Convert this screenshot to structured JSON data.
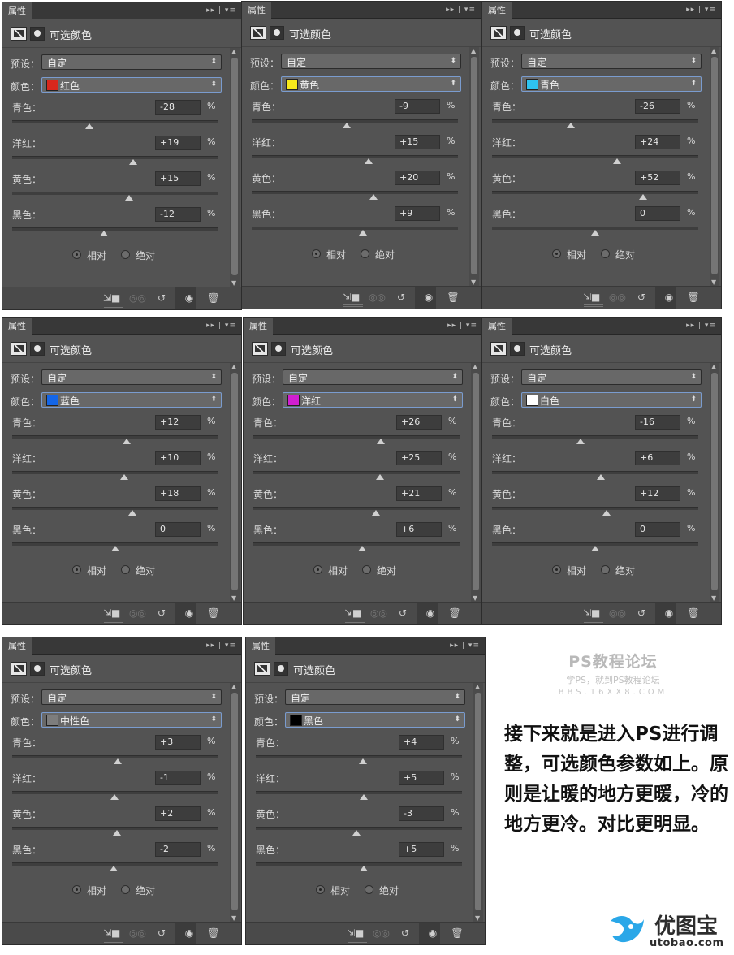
{
  "panel_common": {
    "tab_label": "属性",
    "tab_controls": "▸▸ | ▾≡",
    "title": "可选颜色",
    "preset_label": "预设：",
    "preset_value": "自定",
    "color_label": "颜色：",
    "pct": "%",
    "relative_label": "相对",
    "absolute_label": "绝对",
    "rows": [
      "青色：",
      "洋红：",
      "黄色：",
      "黑色："
    ]
  },
  "panels": [
    {
      "color_name": "红色",
      "swatch": "#d8281c",
      "values": [
        "-28",
        "+19",
        "+15",
        "-12"
      ]
    },
    {
      "color_name": "黄色",
      "swatch": "#f7e91b",
      "values": [
        "-9",
        "+15",
        "+20",
        "+9"
      ]
    },
    {
      "color_name": "青色",
      "swatch": "#2ec3f0",
      "values": [
        "-26",
        "+24",
        "+52",
        "0"
      ]
    },
    {
      "color_name": "蓝色",
      "swatch": "#1466e8",
      "values": [
        "+12",
        "+10",
        "+18",
        "0"
      ]
    },
    {
      "color_name": "洋红",
      "swatch": "#d11ed1",
      "values": [
        "+26",
        "+25",
        "+21",
        "+6"
      ]
    },
    {
      "color_name": "白色",
      "swatch": "#ffffff",
      "values": [
        "-16",
        "+6",
        "+12",
        "0"
      ]
    },
    {
      "color_name": "中性色",
      "swatch": "#7d7d7d",
      "values": [
        "+3",
        "-1",
        "+2",
        "-2"
      ]
    },
    {
      "color_name": "黑色",
      "swatch": "#000000",
      "values": [
        "+4",
        "+5",
        "-3",
        "+5"
      ]
    }
  ],
  "watermark": {
    "title": "PS教程论坛",
    "subtitle": "学PS，就到PS教程论坛",
    "url": "BBS.16XX8.COM"
  },
  "description": "接下来就是进入PS进行调整，可选颜色参数如上。原则是让暖的地方更暖，冷的地方更冷。对比更明显。",
  "logo": {
    "name": "优图宝",
    "url": "utobao.com"
  }
}
